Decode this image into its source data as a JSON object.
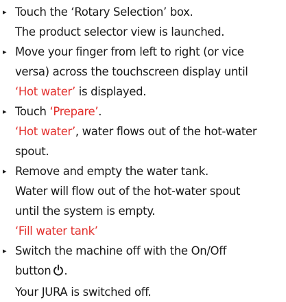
{
  "steps": [
    {
      "lines": [
        {
          "t": "Touch the ‘Rotary Selection’ box."
        },
        {
          "t": "The product selector view is launched."
        }
      ]
    },
    {
      "lines": [
        {
          "t": "Move your finger from left to right (or vice"
        },
        {
          "t": "versa) across the touchscreen display until"
        },
        {
          "t": "‘Hot water’",
          "a": " is displayed."
        }
      ]
    },
    {
      "lines": [
        {
          "pre": "Touch ",
          "r": "‘Prepare’",
          "post": "."
        },
        {
          "r": "‘Hot water’",
          "post": ", water flows out of the hot-water"
        },
        {
          "t": "spout."
        }
      ]
    },
    {
      "lines": [
        {
          "t": "Remove and empty the water tank."
        },
        {
          "t": "Water will flow out of the hot-water spout"
        },
        {
          "t": "until the system is empty."
        },
        {
          "r": "‘Fill water tank’"
        }
      ]
    },
    {
      "lines": [
        {
          "t": "Switch the machine off with the On/Off"
        },
        {
          "t": "button"
        },
        {
          "t": "Your JURA is switched off."
        }
      ]
    }
  ],
  "colors": {
    "text": "#1a1a1a",
    "accent": "#e2302d"
  },
  "icons": {
    "bullet": "▸",
    "power": "power-icon"
  }
}
